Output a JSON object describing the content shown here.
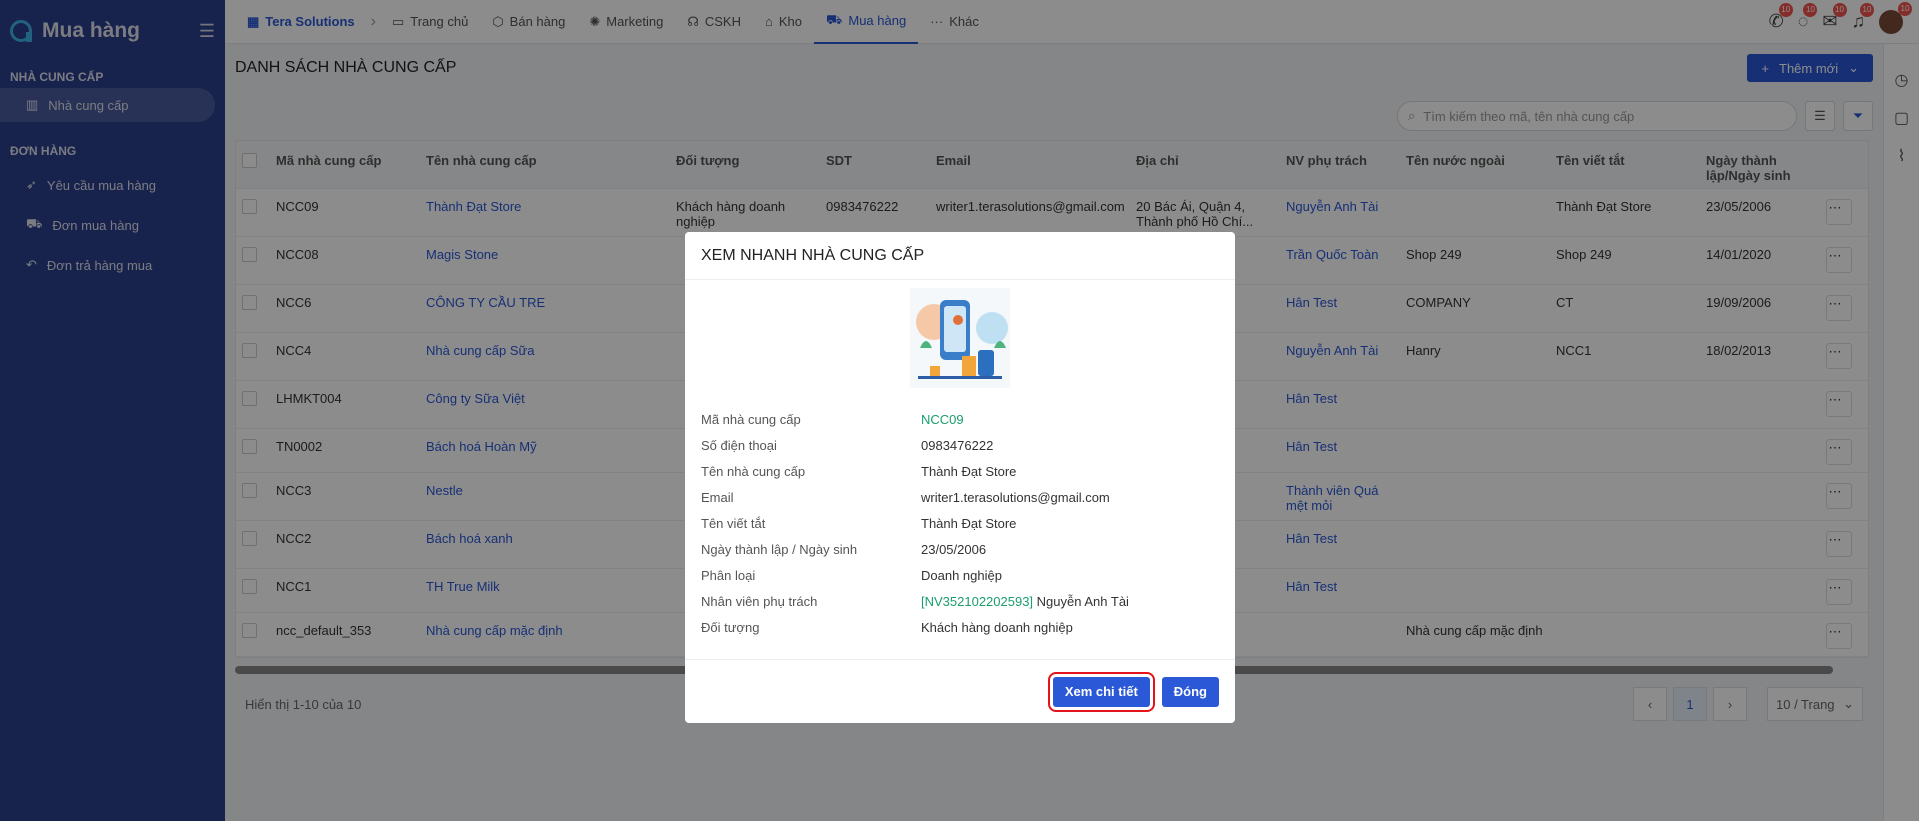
{
  "sidebar": {
    "title": "Mua hàng",
    "section1": "NHÀ CUNG CẤP",
    "supplier_item": "Nhà cung cấp",
    "section2": "ĐƠN HÀNG",
    "items": [
      "Yêu cầu mua hàng",
      "Đơn mua hàng",
      "Đơn trả hàng mua"
    ]
  },
  "topnav": {
    "brand": "Tera Solutions",
    "items": [
      "Trang chủ",
      "Bán hàng",
      "Marketing",
      "CSKH",
      "Kho",
      "Mua hàng",
      "Khác"
    ],
    "badge": "10"
  },
  "page": {
    "title": "DANH SÁCH NHÀ CUNG CẤP",
    "add_label": "Thêm mới",
    "search_placeholder": "Tìm kiếm theo mã, tên nhà cung cấp"
  },
  "table": {
    "headers": [
      "Mã nhà cung cấp",
      "Tên nhà cung cấp",
      "Đối tượng",
      "SDT",
      "Email",
      "Địa chỉ",
      "NV phụ trách",
      "Tên nước ngoài",
      "Tên viết tắt",
      "Ngày thành lập/Ngày sinh"
    ],
    "rows": [
      [
        "NCC09",
        "Thành Đạt Store",
        "Khách hàng doanh nghiệp",
        "0983476222",
        "writer1.terasolutions@gmail.com",
        "20 Bác Ái, Quận 4, Thành phố Hồ Chí...",
        "Nguyễn Anh Tài",
        "",
        "Thành Đạt Store",
        "23/05/2006"
      ],
      [
        "NCC08",
        "Magis Stone",
        "",
        "",
        "",
        "",
        "Trần Quốc Toàn",
        "Shop 249",
        "Shop 249",
        "14/01/2020"
      ],
      [
        "NCC6",
        "CÔNG TY CẦU TRE",
        "",
        "",
        "",
        "",
        "Hân Test",
        "COMPANY",
        "CT",
        "19/09/2006"
      ],
      [
        "NCC4",
        "Nhà cung cấp Sữa",
        "",
        "",
        "",
        "",
        "Nguyễn Anh Tài",
        "Hanry",
        "NCC1",
        "18/02/2013"
      ],
      [
        "LHMKT004",
        "Công ty Sữa Việt",
        "",
        "",
        "",
        "",
        "Hân Test",
        "",
        "",
        ""
      ],
      [
        "TN0002",
        "Bách hoá Hoàn Mỹ",
        "",
        "",
        "",
        "",
        "Hân Test",
        "",
        "",
        ""
      ],
      [
        "NCC3",
        "Nestle",
        "",
        "",
        "",
        "",
        "Thành viên Quá mệt mỏi",
        "",
        "",
        ""
      ],
      [
        "NCC2",
        "Bách hoá xanh",
        "",
        "",
        "",
        "",
        "Hân Test",
        "",
        "",
        ""
      ],
      [
        "NCC1",
        "TH True Milk",
        "",
        "",
        "",
        "",
        "Hân Test",
        "",
        "",
        ""
      ],
      [
        "ncc_default_353",
        "Nhà cung cấp mặc định",
        "",
        "",
        "",
        "",
        "",
        "Nhà cung cấp mặc định",
        "",
        ""
      ]
    ]
  },
  "footer": {
    "summary": "Hiển thị 1-10 của 10",
    "page": "1",
    "page_size": "10 / Trang"
  },
  "modal": {
    "title": "XEM NHANH NHÀ CUNG CẤP",
    "fields": [
      {
        "label": "Mã nhà cung cấp",
        "value": "NCC09"
      },
      {
        "label": "Số điện thoại",
        "value": "0983476222"
      },
      {
        "label": "Tên nhà cung cấp",
        "value": "Thành Đạt Store"
      },
      {
        "label": "Email",
        "value": "writer1.terasolutions@gmail.com"
      },
      {
        "label": "Tên viết tắt",
        "value": "Thành Đạt Store"
      },
      {
        "label": "Ngày thành lập / Ngày sinh",
        "value": "23/05/2006"
      },
      {
        "label": "Phân loại",
        "value": "Doanh nghiệp"
      },
      {
        "label": "Nhân viên phụ trách",
        "value": "Nguyễn Anh Tài",
        "code": "[NV352102202593]"
      },
      {
        "label": "Đối tượng",
        "value": "Khách hàng doanh nghiệp"
      }
    ],
    "detail_button": "Xem chi tiết",
    "close_button": "Đóng"
  },
  "colors": {
    "accent": "#2b58d6",
    "sidebar": "#2a3e8c",
    "highlight": "#e3141b",
    "code_green": "#1a9e6c"
  }
}
